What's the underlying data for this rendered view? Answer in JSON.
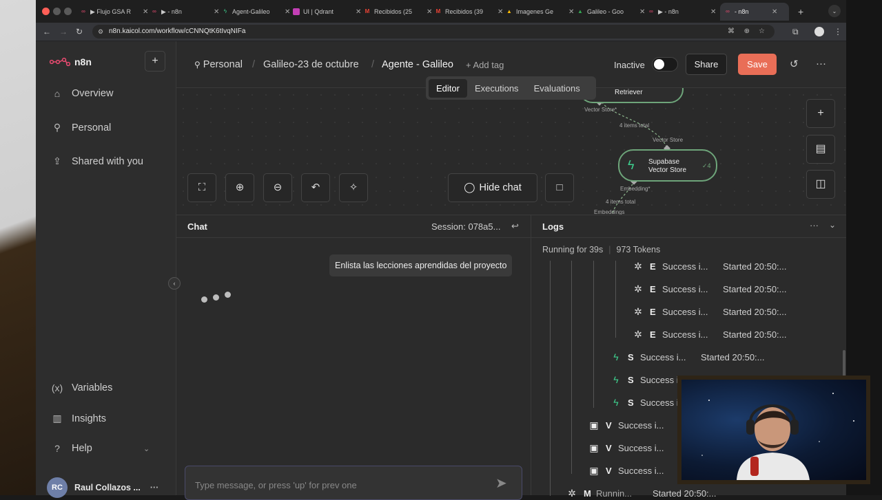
{
  "browser": {
    "tabs": [
      {
        "title": "▶ Flujo GSA R"
      },
      {
        "title": "▶ - n8n"
      },
      {
        "title": "Agent-Galileo"
      },
      {
        "title": "UI | Qdrant"
      },
      {
        "title": "Recibidos (25"
      },
      {
        "title": "Recibidos (39"
      },
      {
        "title": "Imagenes Ge"
      },
      {
        "title": "Galileo - Goo"
      },
      {
        "title": "▶ - n8n"
      },
      {
        "title": "- n8n"
      }
    ],
    "url": "n8n.kaicol.com/workflow/cCNNQtK6tIvqNIFa"
  },
  "sidebar": {
    "brand": "n8n",
    "items": [
      {
        "label": "Overview",
        "icon": "home-icon"
      },
      {
        "label": "Personal",
        "icon": "user-icon"
      },
      {
        "label": "Shared with you",
        "icon": "share-icon"
      }
    ],
    "bottom_items": [
      {
        "label": "Variables",
        "icon": "variables-icon"
      },
      {
        "label": "Insights",
        "icon": "chart-icon"
      },
      {
        "label": "Help",
        "icon": "help-icon"
      }
    ],
    "user": {
      "initials": "RC",
      "name": "Raul Collazos ..."
    }
  },
  "header": {
    "breadcrumb": [
      "Personal",
      "Galileo-23 de octubre",
      "Agente - Galileo"
    ],
    "add_tag": "+ Add tag",
    "status_label": "Inactive",
    "share_label": "Share",
    "save_label": "Save",
    "tabs": [
      "Editor",
      "Executions",
      "Evaluations"
    ],
    "active_tab": "Editor"
  },
  "canvas": {
    "nodes": {
      "retriever": "Retriever",
      "supabase_line1": "Supabase",
      "supabase_line2": "Vector Store",
      "supabase_count": "4"
    },
    "labels": {
      "vector_store_top": "Vector Store*",
      "items_top": "4 items total",
      "vector_store_mid": "Vector Store",
      "embedding": "Embedding*",
      "items_bottom": "4 items total",
      "embeddings": "Embeddings"
    },
    "hide_chat": "Hide chat"
  },
  "chat": {
    "title": "Chat",
    "session": "Session: 078a5...",
    "user_message": "Enlista las lecciones aprendidas del proyecto",
    "input_placeholder": "Type message, or press 'up' for prev one"
  },
  "logs": {
    "title": "Logs",
    "running": "Running for 39s",
    "tokens": "973 Tokens",
    "rows": [
      {
        "letter": "E",
        "status": "Success i...",
        "started": "Started 20:50:...",
        "type": "openai"
      },
      {
        "letter": "E",
        "status": "Success i...",
        "started": "Started 20:50:...",
        "type": "openai"
      },
      {
        "letter": "E",
        "status": "Success i...",
        "started": "Started 20:50:...",
        "type": "openai"
      },
      {
        "letter": "E",
        "status": "Success i...",
        "started": "Started 20:50:...",
        "type": "openai"
      },
      {
        "letter": "S",
        "status": "Success i...",
        "started": "Started 20:50:...",
        "type": "supabase"
      },
      {
        "letter": "S",
        "status": "Success i",
        "started": "",
        "type": "supabase"
      },
      {
        "letter": "S",
        "status": "Success i",
        "started": "",
        "type": "supabase"
      },
      {
        "letter": "V",
        "status": "Success i...",
        "started": "",
        "type": "vector"
      },
      {
        "letter": "V",
        "status": "Success i...",
        "started": "",
        "type": "vector"
      },
      {
        "letter": "V",
        "status": "Success i...",
        "started": "",
        "type": "vector"
      },
      {
        "letter": "M",
        "status": "Runnin...",
        "started": "Started 20:50:...",
        "type": "openai"
      }
    ]
  },
  "colors": {
    "accent": "#e96e57",
    "supabase": "#3ecf8e",
    "node_border": "#6ea57a"
  }
}
